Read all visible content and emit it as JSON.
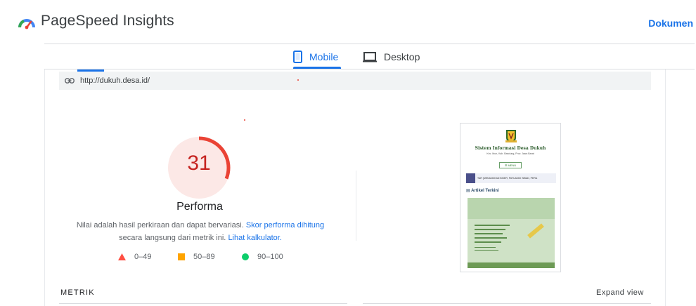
{
  "header": {
    "app_title": "PageSpeed Insights",
    "doc_link": "Dokumen",
    "logo_icon": "pagespeed-logo-icon"
  },
  "tabs": [
    {
      "label": "Mobile",
      "icon": "phone-icon",
      "active": true
    },
    {
      "label": "Desktop",
      "icon": "laptop-icon",
      "active": false
    }
  ],
  "report": {
    "url": "http://dukuh.desa.id/",
    "url_icon": "link-icon",
    "score": "31",
    "score_fraction": 0.31,
    "score_color": "#c5221f",
    "score_bg": "#fce8e6",
    "category": "Performa",
    "desc_text": "Nilai adalah hasil perkiraan dan dapat bervariasi.",
    "desc_link1": "Skor performa dihitung",
    "desc_text2": "secara langsung dari metrik ini.",
    "desc_link2": "Lihat kalkulator.",
    "legend": [
      {
        "label": "0–49",
        "shape": "triangle",
        "color": "#ff4e42"
      },
      {
        "label": "50–89",
        "shape": "square",
        "color": "#ffa400"
      },
      {
        "label": "90–100",
        "shape": "circle",
        "color": "#0cce6b"
      }
    ]
  },
  "thumbnail": {
    "site_title": "Sistem Informasi Desa Dukuh",
    "site_sub": "Kec. Ibun, Kab. Bandung, Prov. Jawa Barat",
    "menu_label": "☰ MENU",
    "news_text": "TAR (MENANGKAN BIKER, PATUANGI SIBAD, PERA",
    "artikel_label": "▤ Artikel Terkini"
  },
  "metrics": {
    "title": "METRIK",
    "expand": "Expand view"
  }
}
